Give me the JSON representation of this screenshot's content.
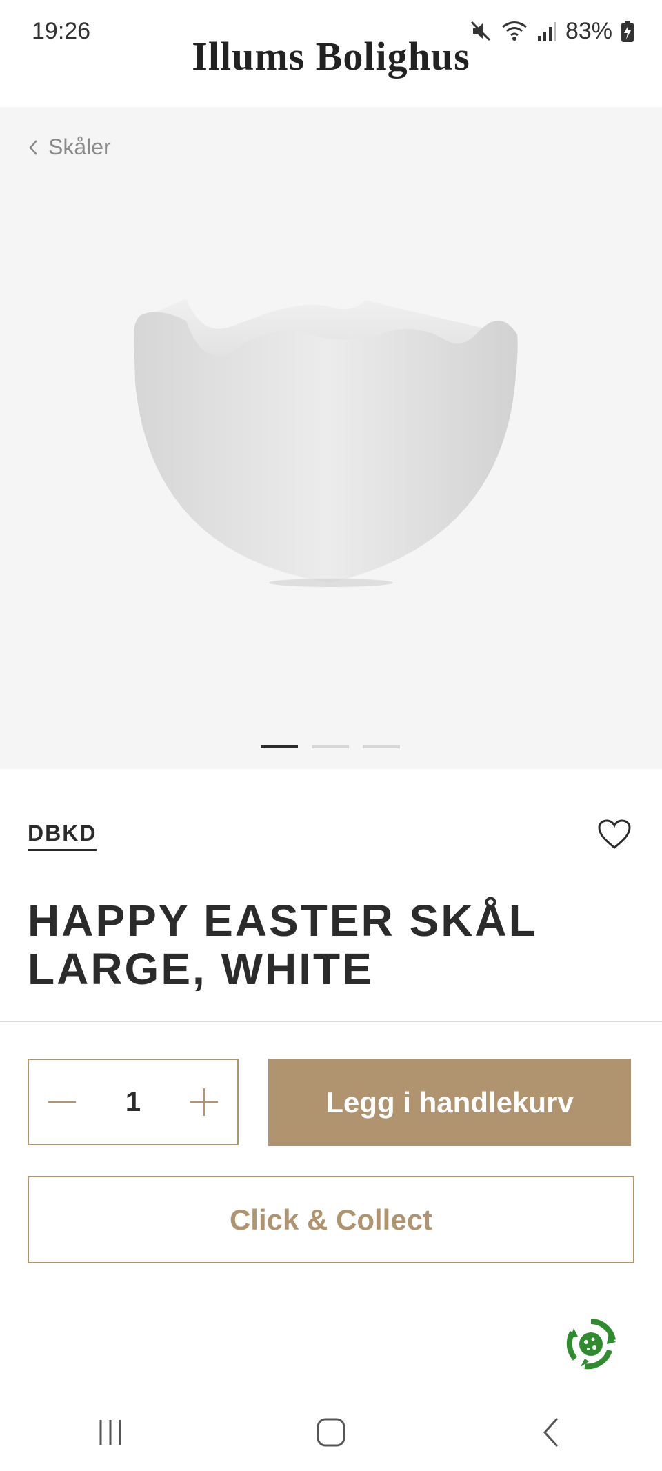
{
  "status_bar": {
    "time": "19:26",
    "battery": "83%"
  },
  "header": {
    "logo_text": "Illums Bolighus"
  },
  "breadcrumb": {
    "label": "Skåler"
  },
  "gallery": {
    "slide_count": 3,
    "active_slide": 1
  },
  "product": {
    "brand": "DBKD",
    "title": "HAPPY EASTER SKÅL LARGE, WHITE",
    "quantity": "1"
  },
  "actions": {
    "add_to_cart": "Legg i handlekurv",
    "click_collect": "Click & Collect"
  },
  "colors": {
    "accent": "#b09470",
    "text": "#2b2b2b",
    "hero_bg": "#f5f5f5",
    "eco_green": "#2e8b2e"
  },
  "icons": {
    "mute": "mute-icon",
    "wifi": "wifi-icon",
    "signal": "signal-icon",
    "battery": "battery-charging-icon",
    "back": "chevron-left-icon",
    "favorite": "heart-icon",
    "minus": "minus-icon",
    "plus": "plus-icon",
    "eco": "recycle-icon",
    "nav_recent": "recent-apps-icon",
    "nav_home": "home-icon",
    "nav_back": "back-icon"
  }
}
